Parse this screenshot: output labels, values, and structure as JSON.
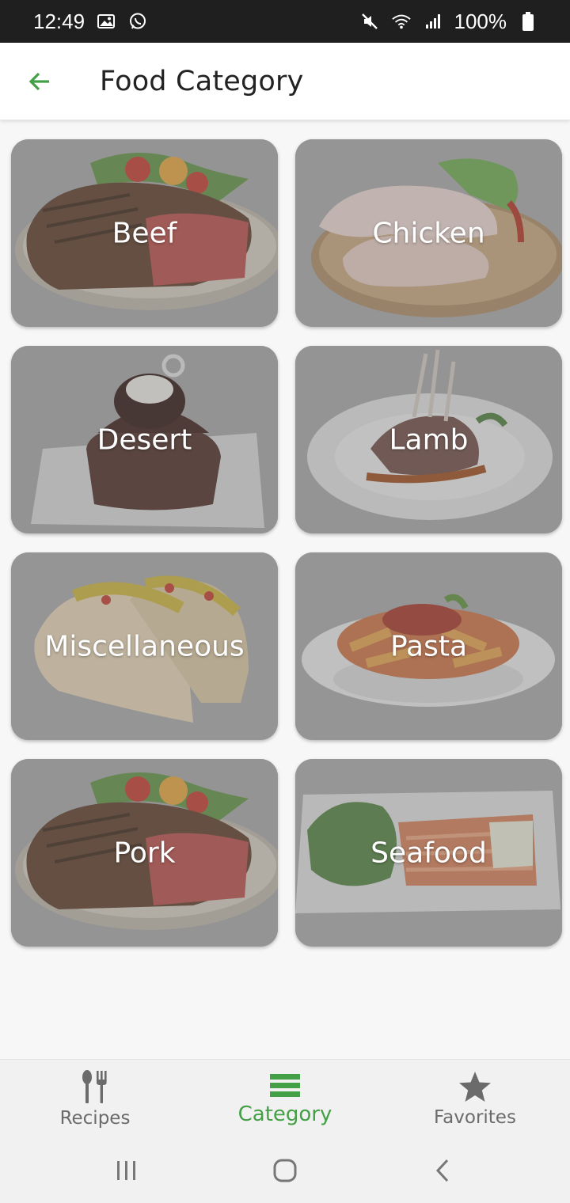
{
  "status_bar": {
    "time": "12:49",
    "battery": "100%",
    "icons": [
      "image-icon",
      "whatsapp-icon",
      "mute-icon",
      "wifi-icon",
      "signal-icon",
      "battery-icon"
    ]
  },
  "app_bar": {
    "title": "Food Category",
    "back_icon": "arrow-left-icon",
    "accent": "#43a047"
  },
  "categories": [
    {
      "label": "Beef"
    },
    {
      "label": "Chicken"
    },
    {
      "label": "Desert"
    },
    {
      "label": "Lamb"
    },
    {
      "label": "Miscellaneous"
    },
    {
      "label": "Pasta"
    },
    {
      "label": "Pork"
    },
    {
      "label": "Seafood"
    }
  ],
  "bottom_nav": {
    "items": [
      {
        "label": "Recipes",
        "icon": "fork-knife-icon",
        "active": false
      },
      {
        "label": "Category",
        "icon": "list-icon",
        "active": true
      },
      {
        "label": "Favorites",
        "icon": "star-icon",
        "active": false
      }
    ],
    "active_color": "#43a047",
    "inactive_color": "#6b6b6b"
  },
  "system_nav": {
    "icons": [
      "recents-icon",
      "home-icon",
      "back-icon"
    ]
  }
}
